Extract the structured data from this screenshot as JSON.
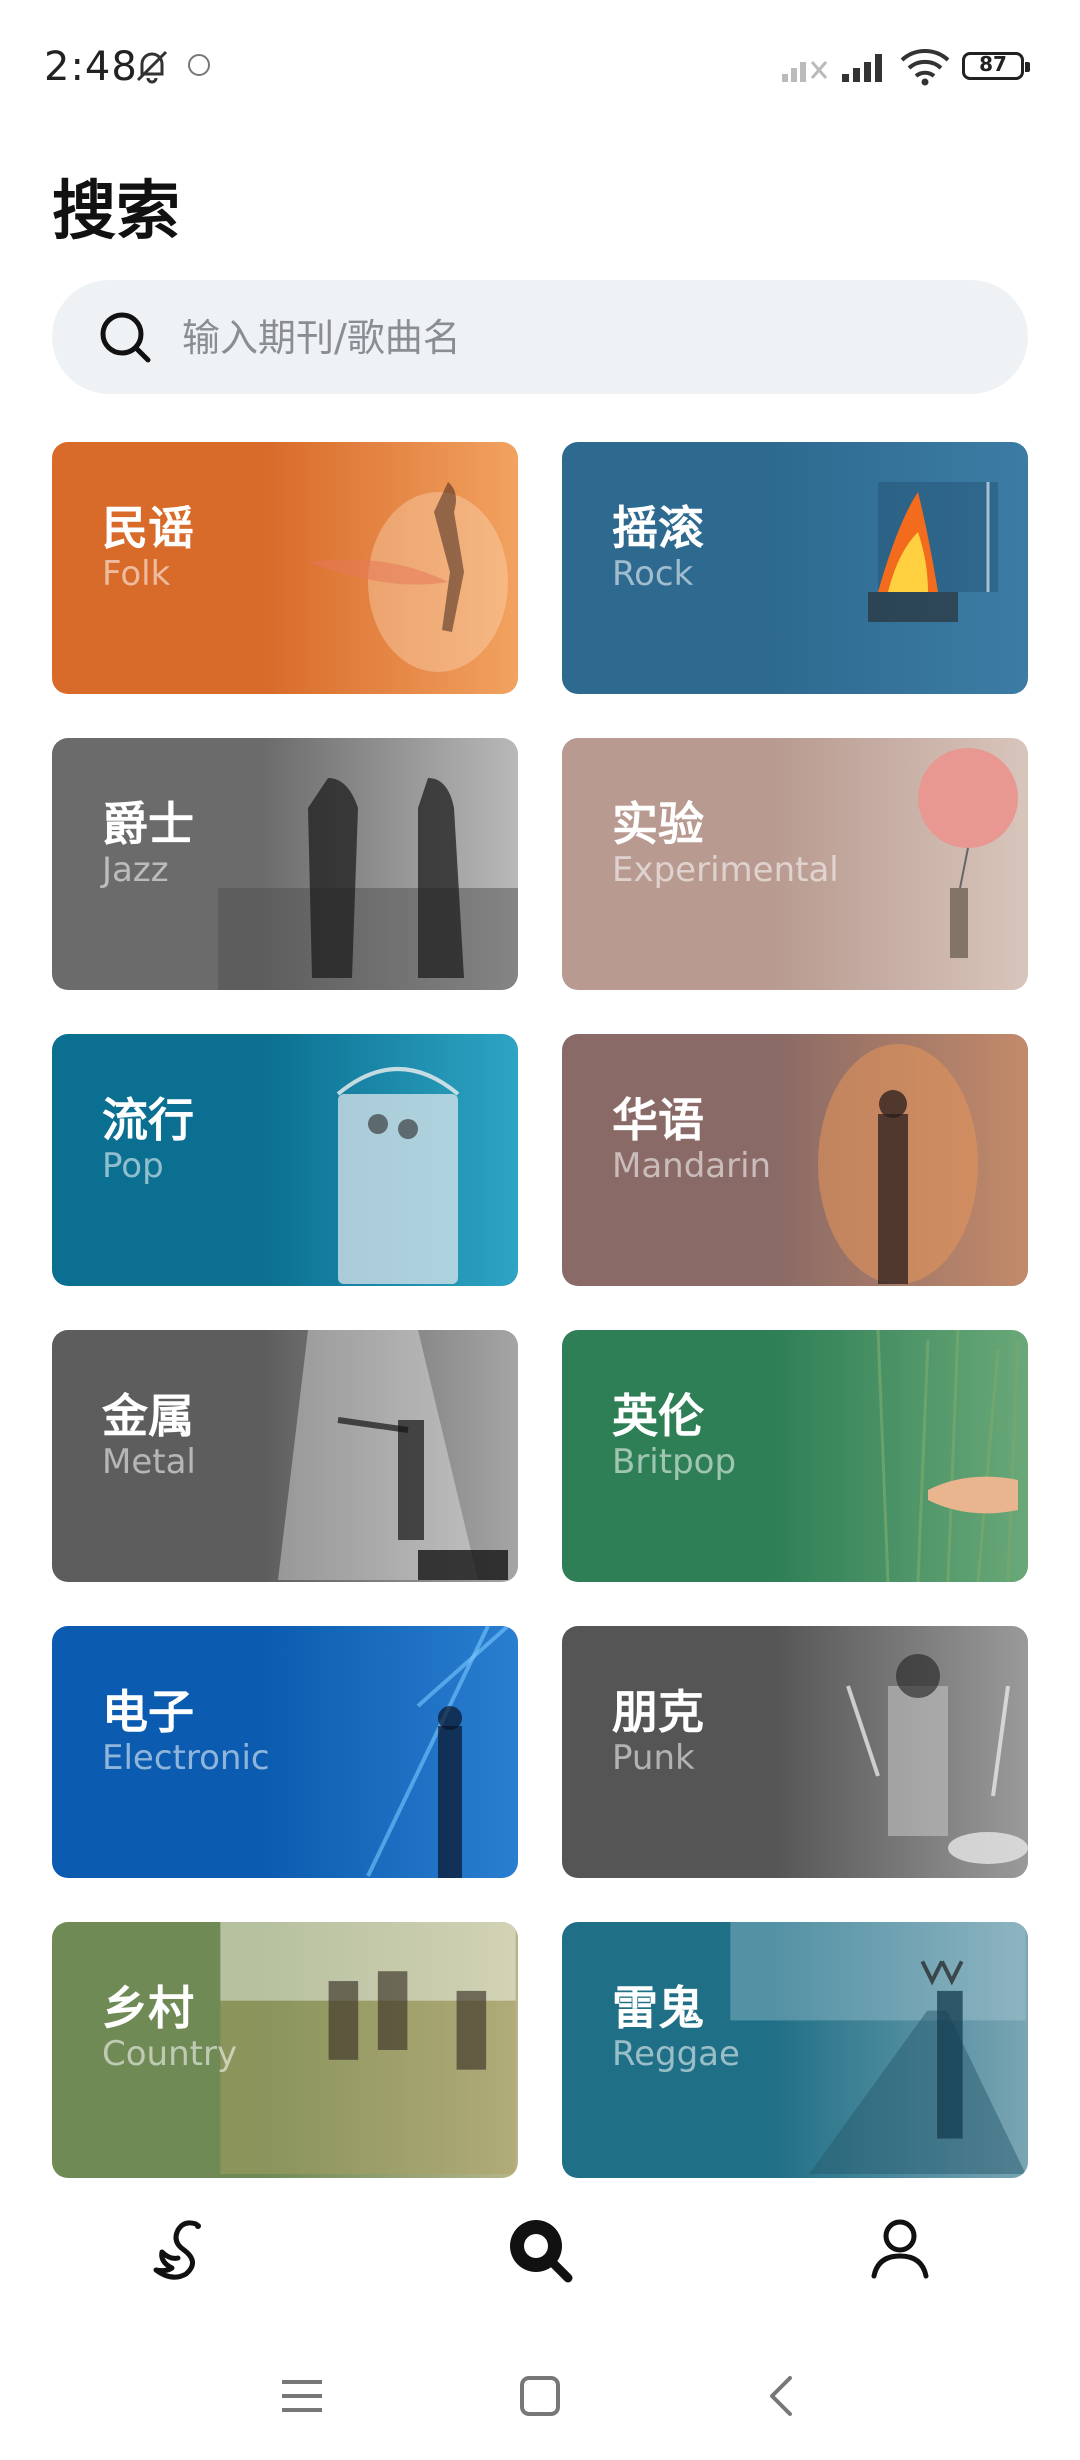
{
  "status": {
    "time": "2:48",
    "battery": "87"
  },
  "title": "搜索",
  "search": {
    "placeholder": "输入期刊/歌曲名"
  },
  "genres": [
    {
      "zh": "民谣",
      "en": "Folk",
      "color": "#d86a2a",
      "color2": "#f2a260"
    },
    {
      "zh": "摇滚",
      "en": "Rock",
      "color": "#2e6a90",
      "color2": "#3c7ca4"
    },
    {
      "zh": "爵士",
      "en": "Jazz",
      "color": "#6b6b6b",
      "color2": "#b9b9b9"
    },
    {
      "zh": "实验",
      "en": "Experimental",
      "color": "#b89a90",
      "color2": "#d8c5bb"
    },
    {
      "zh": "流行",
      "en": "Pop",
      "color": "#0b6f91",
      "color2": "#2ea4c4"
    },
    {
      "zh": "华语",
      "en": "Mandarin",
      "color": "#8a6a66",
      "color2": "#c28a6a"
    },
    {
      "zh": "金属",
      "en": "Metal",
      "color": "#5d5d5d",
      "color2": "#a5a5a5"
    },
    {
      "zh": "英伦",
      "en": "Britpop",
      "color": "#2e7f56",
      "color2": "#6aa878"
    },
    {
      "zh": "电子",
      "en": "Electronic",
      "color": "#0b5cb0",
      "color2": "#2a7ed0"
    },
    {
      "zh": "朋克",
      "en": "Punk",
      "color": "#555555",
      "color2": "#9a9a9a"
    },
    {
      "zh": "乡村",
      "en": "Country",
      "color": "#6f8a55",
      "color2": "#b6b58a"
    },
    {
      "zh": "雷鬼",
      "en": "Reggae",
      "color": "#1f6f86",
      "color2": "#7aa5b3"
    }
  ],
  "nav": [
    {
      "name": "home",
      "icon": "swan-icon"
    },
    {
      "name": "search",
      "icon": "search-icon"
    },
    {
      "name": "profile",
      "icon": "person-icon"
    }
  ]
}
